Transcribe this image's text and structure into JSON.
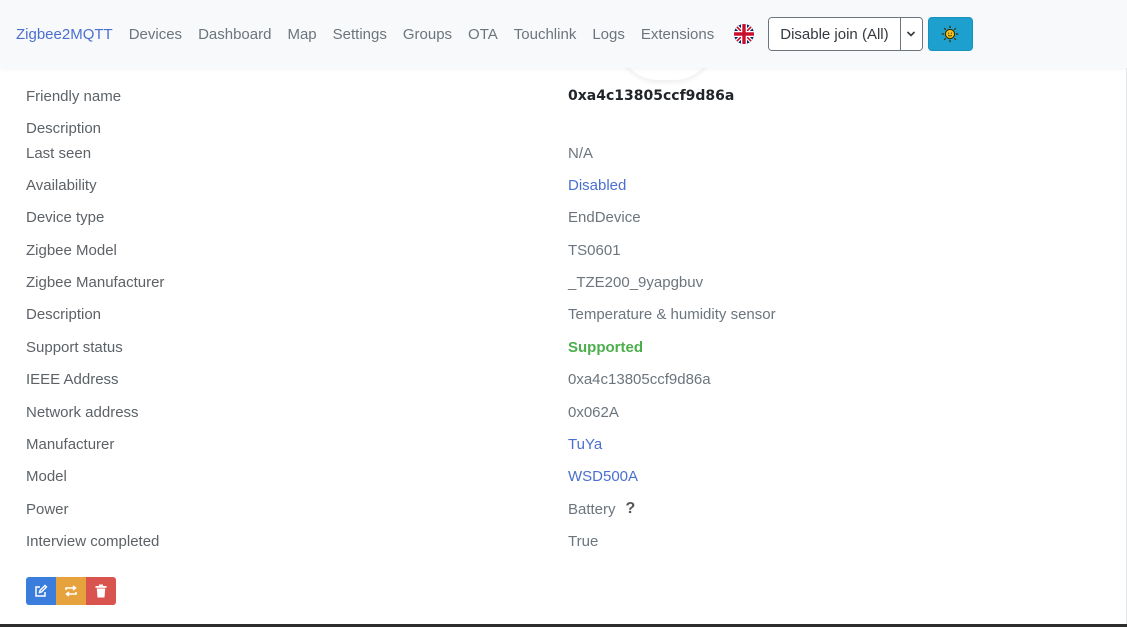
{
  "nav": {
    "brand": "Zigbee2MQTT",
    "items": [
      "Devices",
      "Dashboard",
      "Map",
      "Settings",
      "Groups",
      "OTA",
      "Touchlink",
      "Logs",
      "Extensions"
    ],
    "join_label": "Disable join (All)",
    "language_icon": "uk-flag-icon",
    "theme_icon": "sun-icon"
  },
  "details": [
    {
      "label": "Friendly name",
      "value": "0xa4c13805ccf9d86a",
      "style": "bold"
    },
    {
      "label": "Description",
      "value": "",
      "style": "plain"
    },
    {
      "label": "Last seen",
      "value": "N/A",
      "style": "plain"
    },
    {
      "label": "Availability",
      "value": "Disabled",
      "style": "link"
    },
    {
      "label": "Device type",
      "value": "EndDevice",
      "style": "plain"
    },
    {
      "label": "Zigbee Model",
      "value": "TS0601",
      "style": "plain"
    },
    {
      "label": "Zigbee Manufacturer",
      "value": "_TZE200_9yapgbuv",
      "style": "plain"
    },
    {
      "label": "Description",
      "value": "Temperature & humidity sensor",
      "style": "plain"
    },
    {
      "label": "Support status",
      "value": "Supported",
      "style": "success"
    },
    {
      "label": "IEEE Address",
      "value": "0xa4c13805ccf9d86a",
      "style": "plain"
    },
    {
      "label": "Network address",
      "value": "0x062A",
      "style": "plain"
    },
    {
      "label": "Manufacturer",
      "value": "TuYa",
      "style": "link"
    },
    {
      "label": "Model",
      "value": "WSD500A",
      "style": "link"
    },
    {
      "label": "Power",
      "value": "Battery",
      "style": "plain",
      "help": "?"
    },
    {
      "label": "Interview completed",
      "value": "True",
      "style": "plain"
    }
  ],
  "colors": {
    "link": "#4a6fcf",
    "success": "#4cae4c",
    "theme_button": "#1ea0cf",
    "edit_button": "#3b7ddd",
    "swap_button": "#e6a23c",
    "delete_button": "#d9534f"
  },
  "actions": {
    "edit_icon": "edit-icon",
    "swap_icon": "swap-icon",
    "delete_icon": "trash-icon"
  }
}
